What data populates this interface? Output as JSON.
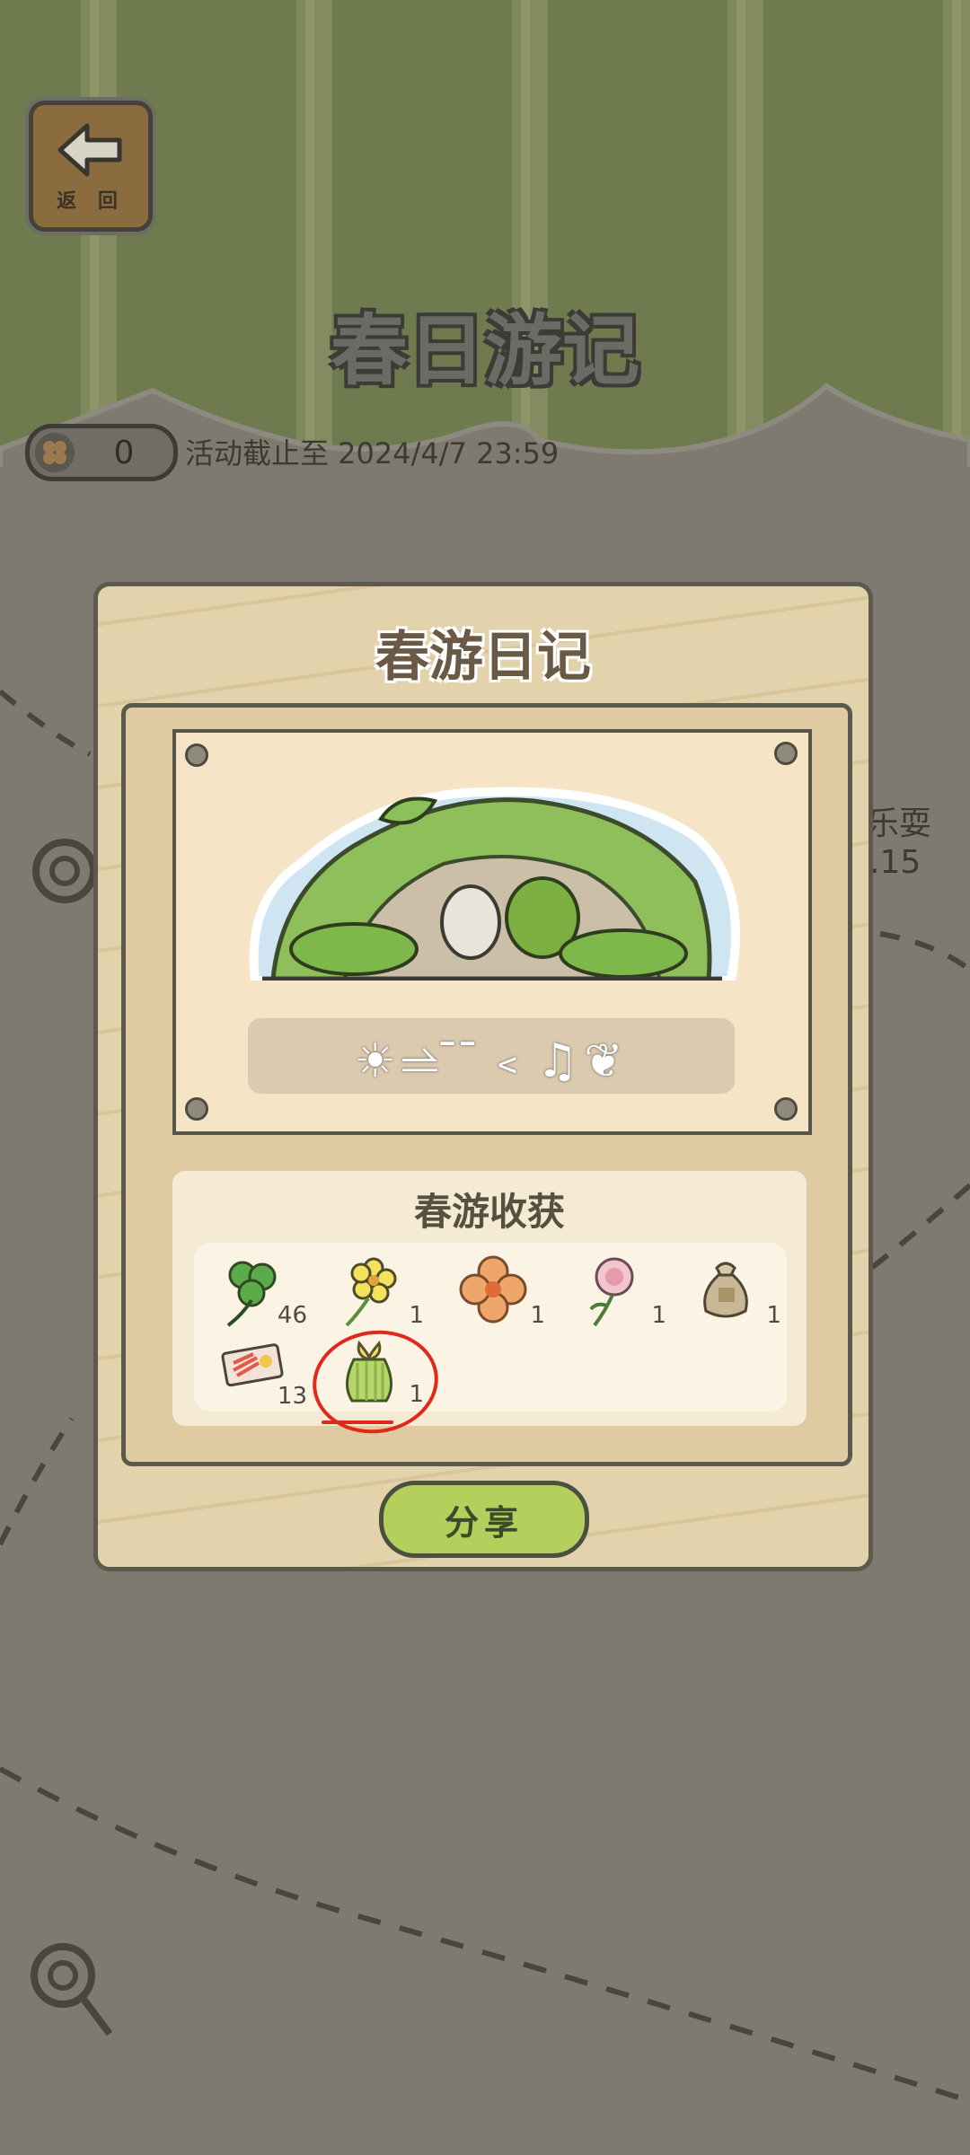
{
  "header": {
    "back_label": "返 回",
    "title": "春日游记",
    "clover_count": "0",
    "deadline": "活动截止至 2024/4/7 23:59"
  },
  "background_text": {
    "line1": "乐耍",
    "line2": ".15"
  },
  "modal": {
    "title": "春游日记",
    "diary_symbols": "☀⥬ ̄ ̄﹤♫❦",
    "harvest_title": "春游收获",
    "items": [
      {
        "icon": "clover-icon",
        "count": "46"
      },
      {
        "icon": "yellow-flower-icon",
        "count": "1"
      },
      {
        "icon": "orange-flower-icon",
        "count": "1"
      },
      {
        "icon": "carnation-icon",
        "count": "1"
      },
      {
        "icon": "seed-bag-icon",
        "count": "1"
      },
      {
        "icon": "ticket-icon",
        "count": "13"
      },
      {
        "icon": "green-gift-bag-icon",
        "count": "1"
      }
    ],
    "share_label": "分享"
  },
  "colors": {
    "share_button": "#b4cf5b",
    "annotation": "#e0291b",
    "modal_bg": "#e3d3ad"
  }
}
